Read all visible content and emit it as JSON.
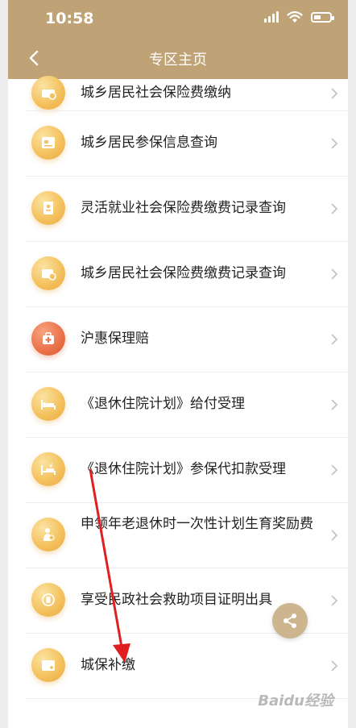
{
  "status": {
    "time": "10:58"
  },
  "nav": {
    "title": "专区主页"
  },
  "items": [
    {
      "label": "城乡居民社会保险费缴纳",
      "icon": "pay-icon"
    },
    {
      "label": "城乡居民参保信息查询",
      "icon": "info-card-icon"
    },
    {
      "label": "灵活就业社会保险费缴费记录查询",
      "icon": "record-icon"
    },
    {
      "label": "城乡居民社会保险费缴费记录查询",
      "icon": "payment-record-icon"
    },
    {
      "label": "沪惠保理赔",
      "icon": "medical-kit-icon"
    },
    {
      "label": "《退休住院计划》给付受理",
      "icon": "hospital-bed-icon"
    },
    {
      "label": "《退休住院计划》参保代扣款受理",
      "icon": "bed-yuan-icon"
    },
    {
      "label": "申领年老退休时一次性计划生育奖励费",
      "icon": "person-reward-icon"
    },
    {
      "label": "享受民政社会救助项目证明出具",
      "icon": "certificate-icon"
    },
    {
      "label": "城保补缴",
      "icon": "wallet-plus-icon"
    }
  ],
  "watermark": "Baidu经验"
}
